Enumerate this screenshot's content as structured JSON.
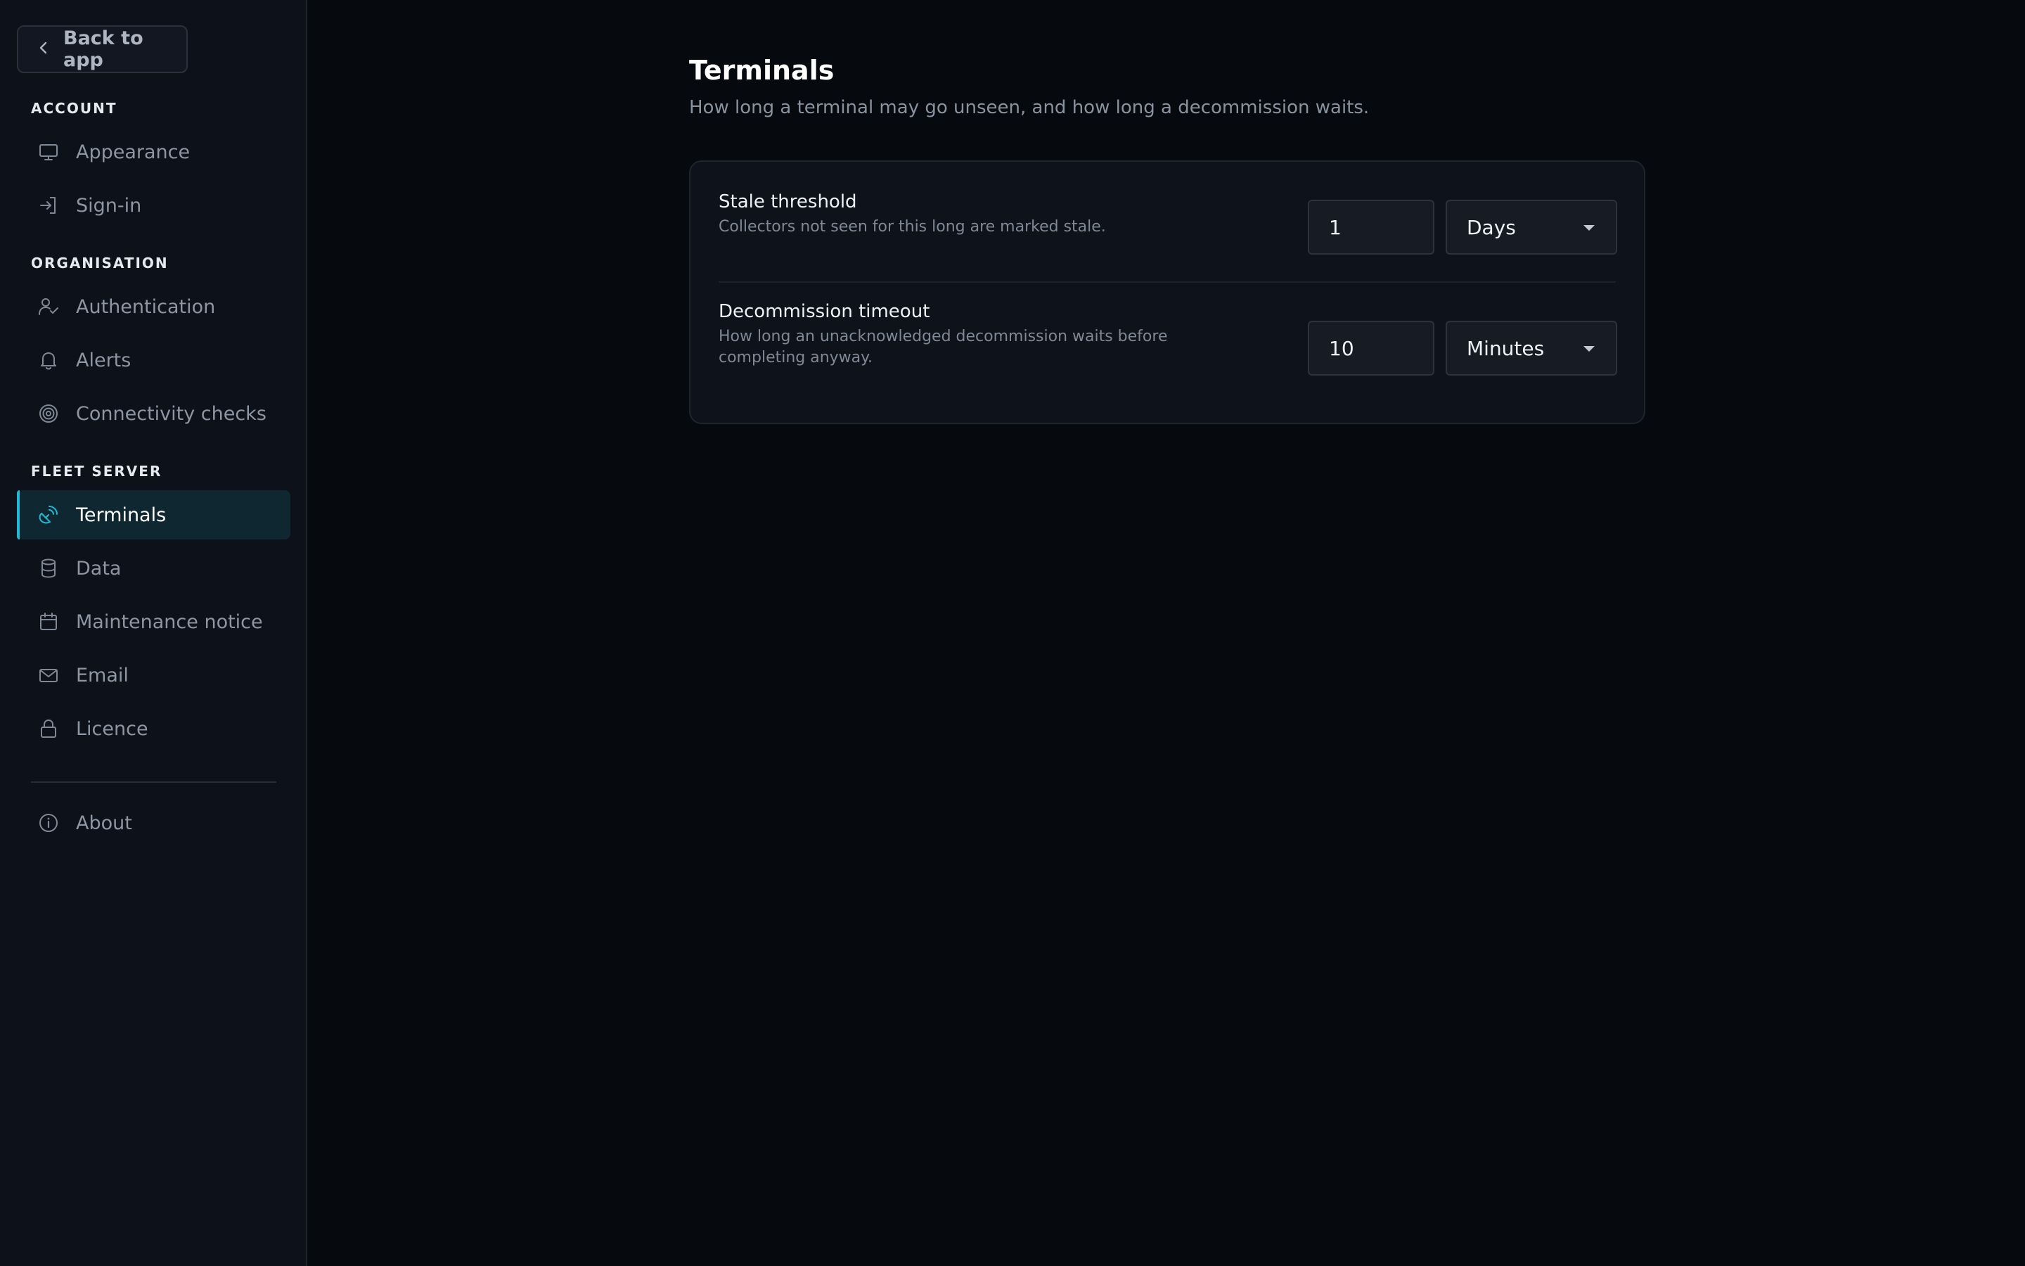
{
  "sidebar": {
    "back_label": "Back to app",
    "sections": {
      "account": "ACCOUNT",
      "organisation": "ORGANISATION",
      "fleet_server": "FLEET SERVER"
    },
    "items": {
      "appearance": "Appearance",
      "signin": "Sign-in",
      "authentication": "Authentication",
      "alerts": "Alerts",
      "connectivity": "Connectivity checks",
      "terminals": "Terminals",
      "data": "Data",
      "maintenance": "Maintenance notice",
      "email": "Email",
      "licence": "Licence",
      "about": "About"
    },
    "active_item": "Terminals"
  },
  "main": {
    "title": "Terminals",
    "subtitle": "How long a terminal may go unseen, and how long a decommission waits.",
    "settings": {
      "stale": {
        "label": "Stale threshold",
        "description": "Collectors not seen for this long are marked stale.",
        "value": "1",
        "unit": "Days"
      },
      "decommission": {
        "label": "Decommission timeout",
        "description": "How long an unacknowledged decommission waits before completing anyway.",
        "value": "10",
        "unit": "Minutes"
      }
    }
  },
  "colors": {
    "accent": "#22b8d4",
    "background": "#06090e",
    "sidebar": "#0d1119"
  }
}
